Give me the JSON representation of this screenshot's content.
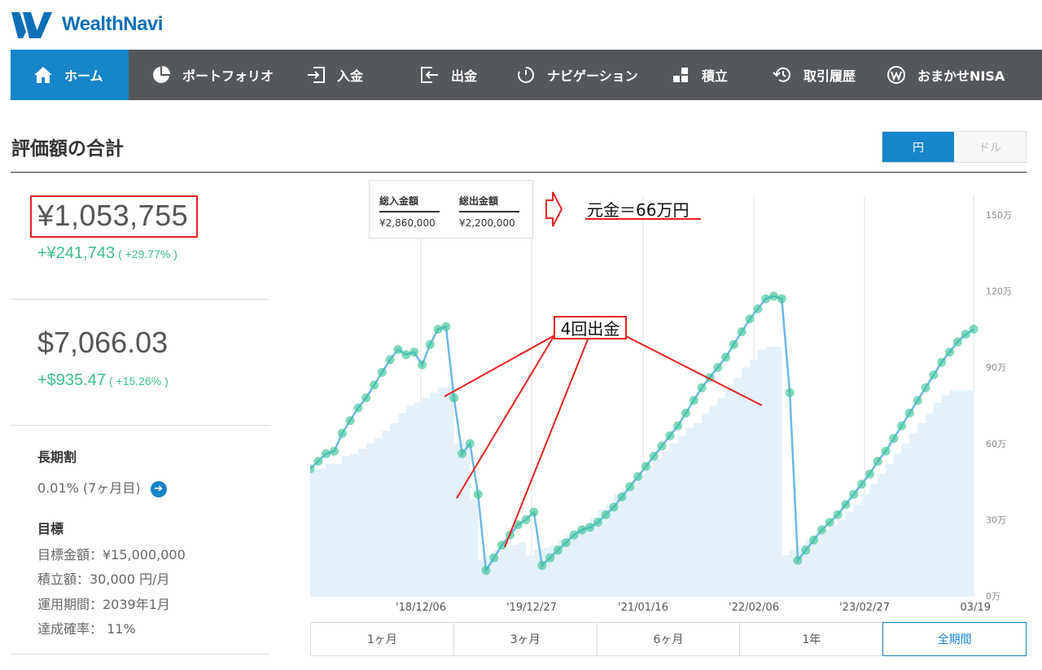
{
  "brand": {
    "name": "WealthNavi",
    "color": "#0d6fb6"
  },
  "nav": {
    "items": [
      {
        "label": "ホーム",
        "icon": "home-icon",
        "active": true
      },
      {
        "label": "ポートフォリオ",
        "icon": "pie-chart-icon"
      },
      {
        "label": "入金",
        "icon": "deposit-icon"
      },
      {
        "label": "出金",
        "icon": "withdraw-icon"
      },
      {
        "label": "ナビゲーション",
        "icon": "navigation-icon"
      },
      {
        "label": "積立",
        "icon": "accumulate-icon"
      },
      {
        "label": "取引履歴",
        "icon": "history-icon"
      },
      {
        "label": "おまかせNISA",
        "icon": "nisa-icon"
      }
    ]
  },
  "page": {
    "title": "評価額の合計"
  },
  "currency_toggle": {
    "options": [
      "円",
      "ドル"
    ],
    "selected": "円"
  },
  "summary": {
    "jpy_total": "¥1,053,755",
    "jpy_gain": "+¥241,743",
    "jpy_gain_pct": "( +29.77% )",
    "usd_total": "$7,066.03",
    "usd_gain": "+$935.47",
    "usd_gain_pct": "( +15.26% )"
  },
  "long_term": {
    "label": "長期割",
    "value": "0.01% (7ヶ月目)"
  },
  "goal": {
    "label": "目標",
    "target_amount": "目標金額：¥15,000,000",
    "monthly": "積立額：30,000 円/月",
    "period": "運用期間：2039年1月",
    "probability": "達成確率： 11%"
  },
  "legend": {
    "deposit_label": "総入金額",
    "deposit_value": "¥2,860,000",
    "withdraw_label": "総出金額",
    "withdraw_value": "¥2,200,000"
  },
  "annotations": {
    "principal": "元金＝66万円",
    "withdrawals": "4回出金"
  },
  "colors": {
    "accent": "#1685c9",
    "gain": "#3dbf8a",
    "annotation": "#e52222",
    "area": "#e4f1f9",
    "line": "#6cb8e6",
    "point": "#3cc497"
  },
  "chart_data": {
    "type": "line",
    "x_ticks": [
      "'18/12/06",
      "'19/12/27",
      "'21/01/16",
      "'22/02/06",
      "'23/02/27",
      "03/19"
    ],
    "y_ticks": [
      "150万",
      "120万",
      "90万",
      "60万",
      "30万",
      "0万"
    ],
    "ylim": [
      0,
      150
    ],
    "series": [
      {
        "values": [
          50,
          53,
          56,
          57,
          64,
          69,
          74,
          78,
          83,
          88,
          93,
          97,
          95,
          96,
          91,
          99,
          105,
          106,
          78,
          56,
          60,
          40,
          10,
          15,
          20,
          24,
          28,
          30,
          33,
          12,
          15,
          18,
          21,
          24,
          26,
          27,
          29,
          32,
          35,
          39,
          43,
          47,
          51,
          55,
          59,
          63,
          67,
          72,
          77,
          82,
          86,
          90,
          94,
          99,
          104,
          109,
          113,
          117,
          118,
          117,
          80,
          14,
          18,
          22,
          26,
          29,
          32,
          36,
          40,
          44,
          48,
          53,
          57,
          62,
          67,
          72,
          77,
          82,
          87,
          92,
          96,
          100,
          103,
          105
        ]
      },
      {
        "values": [
          50,
          50,
          52,
          52,
          55,
          56,
          58,
          60,
          62,
          65,
          68,
          72,
          75,
          76,
          78,
          80,
          82,
          82,
          60,
          60,
          38,
          14,
          16,
          18,
          19,
          20,
          21,
          16,
          18,
          19,
          20,
          22,
          24,
          26,
          28,
          31,
          34,
          36,
          40,
          42,
          45,
          48,
          51,
          54,
          57,
          60,
          63,
          66,
          68,
          72,
          75,
          78,
          82,
          86,
          90,
          93,
          97,
          98,
          98,
          16,
          18,
          20,
          22,
          24,
          26,
          28,
          30,
          33,
          36,
          40,
          44,
          48,
          52,
          56,
          60,
          64,
          68,
          72,
          76,
          79,
          81,
          81,
          81,
          81
        ]
      }
    ]
  },
  "periods": {
    "items": [
      "1ヶ月",
      "3ヶ月",
      "6ヶ月",
      "1年",
      "全期間"
    ],
    "selected": "全期間"
  }
}
